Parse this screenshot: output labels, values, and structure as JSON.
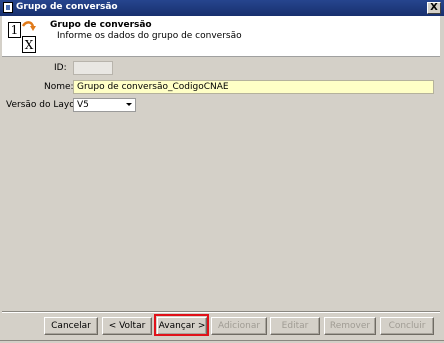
{
  "window": {
    "title": "Grupo de conversão",
    "close_label": "X"
  },
  "header": {
    "title": "Grupo de conversão",
    "subtitle": "Informe os dados do grupo de conversão",
    "icon_card1": "1",
    "icon_card2": "X",
    "icon": "wizard-numbers-icon"
  },
  "form": {
    "id_label": "ID:",
    "id_value": "",
    "name_label": "Nome:",
    "name_value": "Grupo de conversão_CodigoCNAE",
    "layout_label": "Versão do Layout:",
    "layout_value": "V5"
  },
  "buttons": {
    "cancel": "Cancelar",
    "back": "< Voltar",
    "next": "Avançar >",
    "add": "Adicionar",
    "edit": "Editar",
    "remove": "Remover",
    "finish": "Concluir"
  },
  "colors": {
    "titlebar": "#26458e",
    "name_field_bg": "#ffffc6",
    "highlight": "#e0121a"
  }
}
